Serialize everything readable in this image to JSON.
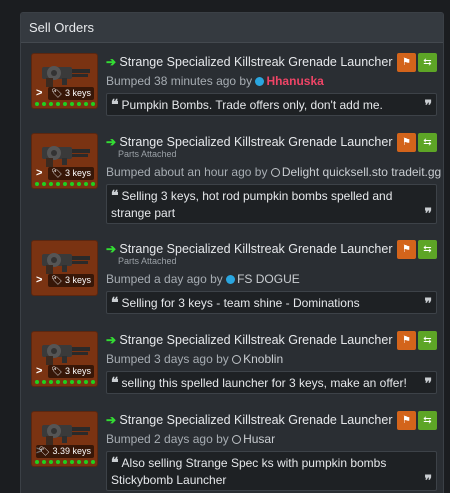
{
  "panel": {
    "title": "Sell Orders"
  },
  "orders": [
    {
      "price": "3 keys",
      "title": "Strange Specialized Killstreak Grenade Launcher",
      "parts": "",
      "bumped_prefix": "Bumped 38 minutes ago by",
      "user": "Hhanuska",
      "user_status": "online",
      "comment": "Pumpkin Bombs. Trade offers only, don't add me."
    },
    {
      "price": "3 keys",
      "title": "Strange Specialized Killstreak Grenade Launcher",
      "parts": "Parts Attached",
      "bumped_prefix": "Bumped about an hour ago by",
      "user": "Delight quicksell.sto tradeit.gg",
      "user_status": "offline",
      "comment": "Selling 3 keys, hot rod pumpkin bombs spelled and strange part"
    },
    {
      "price": "3 keys",
      "title": "Strange Specialized Killstreak Grenade Launcher",
      "parts": "Parts Attached",
      "bumped_prefix": "Bumped a day ago by",
      "user": "FS DOGUE",
      "user_status": "online",
      "comment": "Selling for 3 keys - team shine - Dominations"
    },
    {
      "price": "3 keys",
      "title": "Strange Specialized Killstreak Grenade Launcher",
      "parts": "",
      "bumped_prefix": "Bumped 3 days ago by",
      "user": "Knoblin",
      "user_status": "offline",
      "comment": "selling this spelled launcher for 3 keys, make an offer!"
    },
    {
      "price": "3.39 keys",
      "title": "Strange Specialized Killstreak Grenade Launcher",
      "parts": "",
      "bumped_prefix": "Bumped 2 days ago by",
      "user": "Husar",
      "user_status": "offline",
      "comment": "Also selling Strange Spec ks with pumpkin bombs Stickybomb Launcher"
    }
  ],
  "icons": {
    "arrow": "arrow-right-icon",
    "flag": "flag-icon",
    "trade": "trade-arrows-icon",
    "tag": "tag-icon",
    "quote": "quote-icon"
  },
  "colors": {
    "item_background": "#7a3312",
    "flag_button": "#d3641b",
    "trade_button": "#5da526",
    "online_dot": "#2aa6e0",
    "highlight_user": "#ee4466"
  }
}
